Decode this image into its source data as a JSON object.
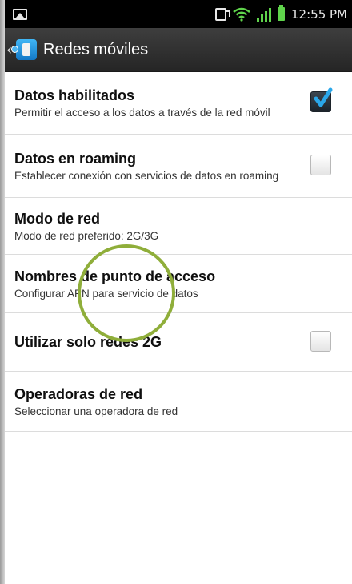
{
  "status_bar": {
    "time": "12:55 PM",
    "icons": [
      "gallery-icon",
      "nfc-icon",
      "wifi-icon",
      "signal-icon",
      "battery-icon"
    ]
  },
  "title_bar": {
    "title": "Redes móviles",
    "icon": "network-settings-icon"
  },
  "settings": [
    {
      "title": "Datos habilitados",
      "subtitle": "Permitir el acceso a los datos a través de la red móvil",
      "checkbox": true,
      "checked": true
    },
    {
      "title": "Datos en roaming",
      "subtitle": "Establecer conexión con servicios de datos en roaming",
      "checkbox": true,
      "checked": false
    },
    {
      "title": "Modo de red",
      "subtitle": "Modo de red preferido: 2G/3G",
      "checkbox": false
    },
    {
      "title": "Nombres de punto de acceso",
      "subtitle": "Configurar APN para servicio de datos",
      "checkbox": false
    },
    {
      "title": "Utilizar solo redes 2G",
      "subtitle": "",
      "checkbox": true,
      "checked": false
    },
    {
      "title": "Operadoras de red",
      "subtitle": "Seleccionar una operadora de red",
      "checkbox": false
    }
  ],
  "colors": {
    "accent_check": "#2aa7ea",
    "highlight_circle": "#8fae3a",
    "status_green": "#5fd34b"
  }
}
